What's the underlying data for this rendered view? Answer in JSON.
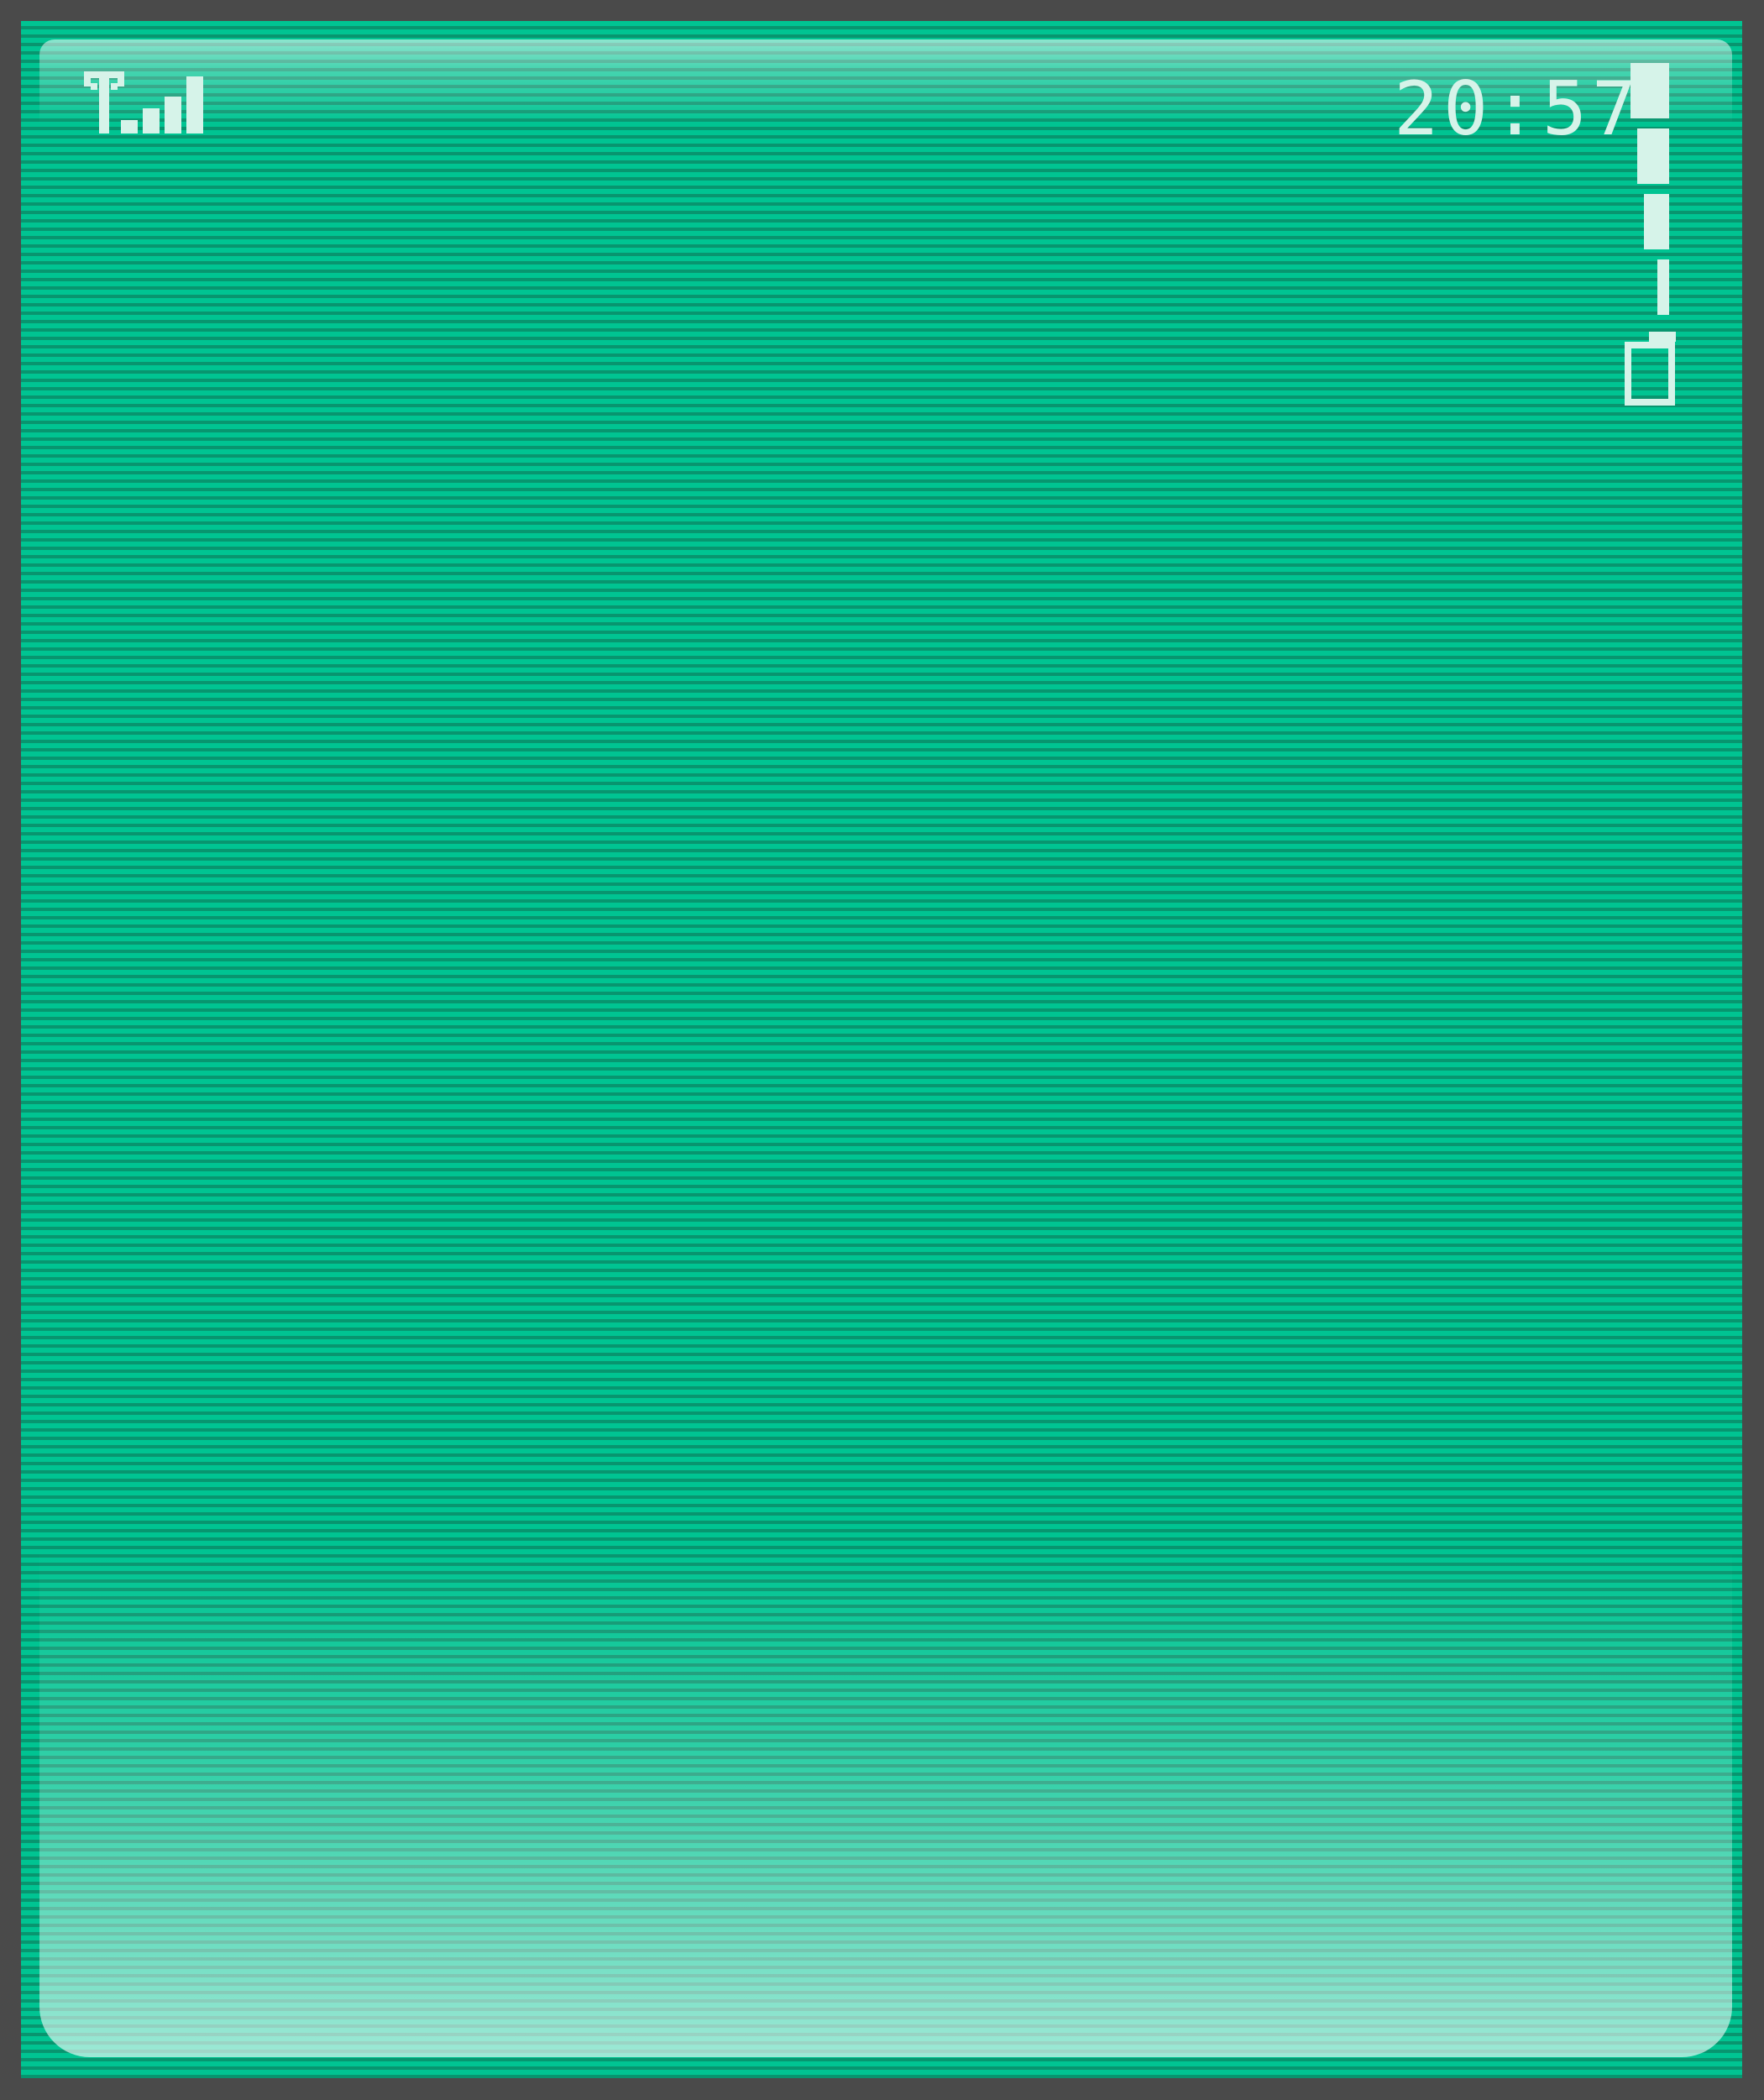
{
  "status_bar": {
    "time": "20:57",
    "signal_icon": "antenna-signal-icon",
    "signal_bars": 4,
    "battery_icon": "battery-level-icon",
    "battery_segments": 4
  },
  "display": {
    "screen_color": "#00bb8c",
    "scanline_color": "#08956f",
    "bezel_color": "#4a4a4a",
    "glyph_color": "#d6f3e9"
  }
}
